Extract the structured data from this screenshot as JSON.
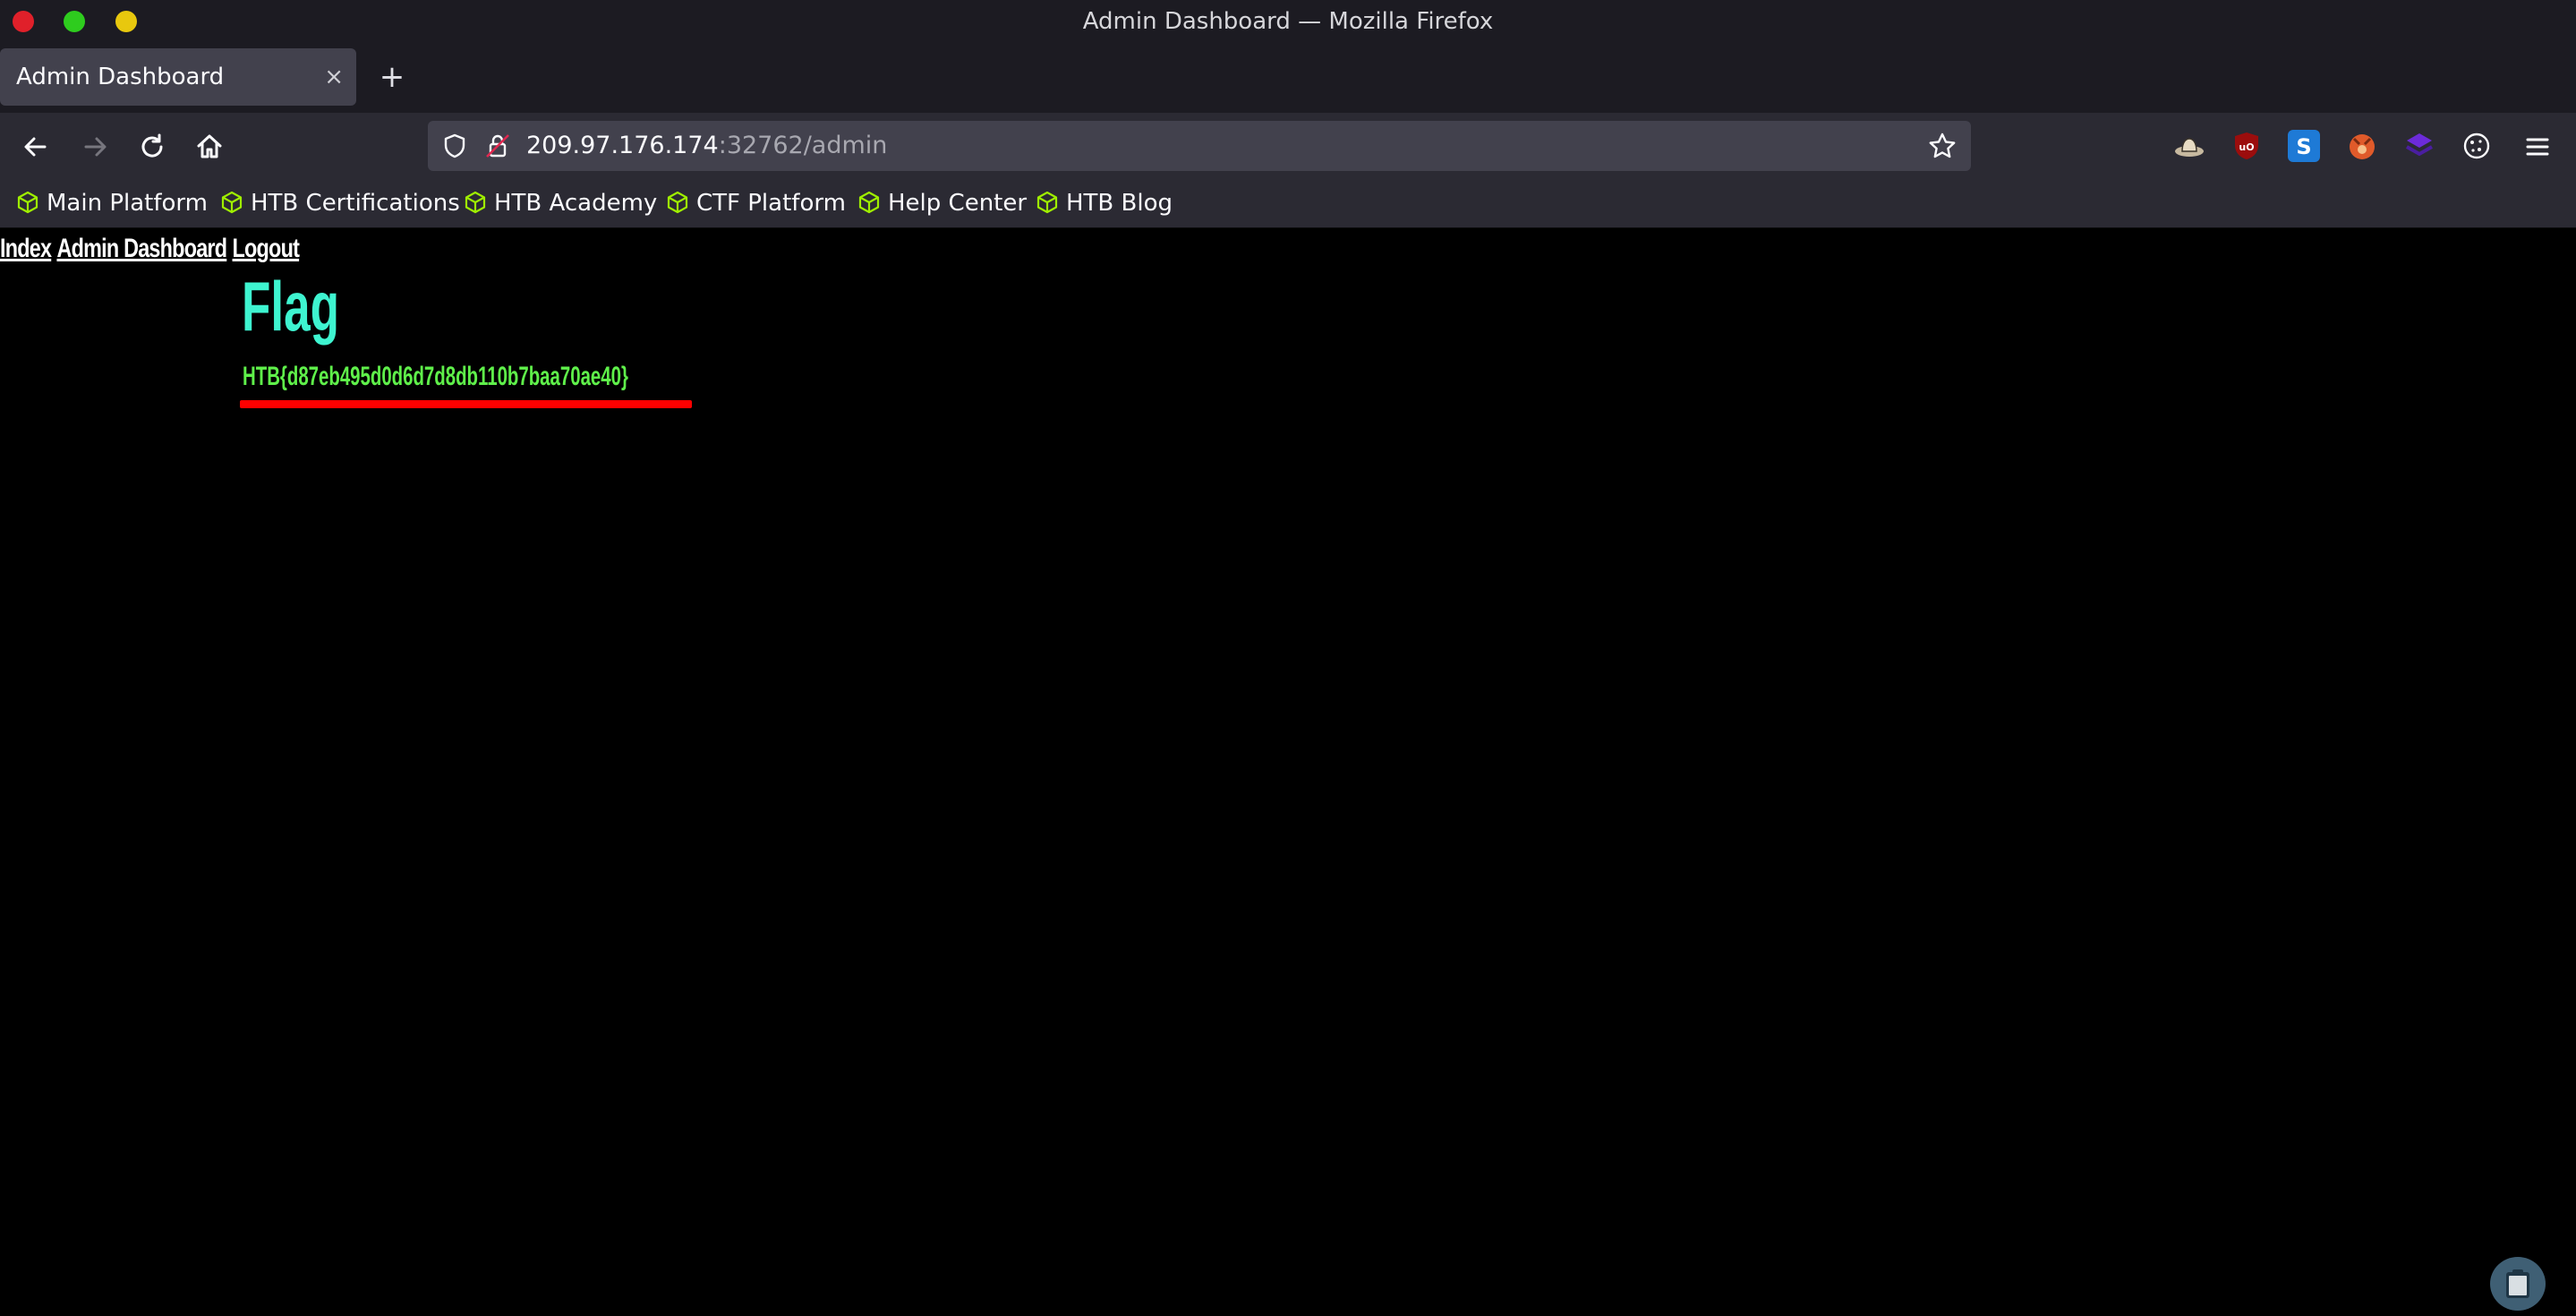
{
  "window": {
    "title": "Admin Dashboard — Mozilla Firefox"
  },
  "tabs": [
    {
      "label": "Admin Dashboard",
      "close_glyph": "×"
    }
  ],
  "new_tab_glyph": "+",
  "address": {
    "host": "209.97.176.174",
    "rest": ":32762/admin"
  },
  "bookmarks": [
    {
      "label": "Main Platform",
      "icon": "htb-cube-icon"
    },
    {
      "label": "HTB Certifications",
      "icon": "htb-cube-icon"
    },
    {
      "label": "HTB Academy",
      "icon": "htb-cube-icon"
    },
    {
      "label": "CTF Platform",
      "icon": "htb-cube-icon"
    },
    {
      "label": "Help Center",
      "icon": "htb-cube-icon"
    },
    {
      "label": "HTB Blog",
      "icon": "htb-cube-icon"
    }
  ],
  "extensions": [
    "cowboy-hat-extension-icon",
    "ublock-origin-icon",
    "s-extension-icon",
    "foxyproxy-icon",
    "wappalyzer-icon",
    "cookie-editor-icon"
  ],
  "page": {
    "nav_links": [
      "Index",
      "Admin Dashboard",
      "Logout"
    ],
    "heading": "Flag",
    "flag": "HTB{d87eb495d0d6d7d8db110b7baa70ae40}"
  },
  "colors": {
    "heading": "#3ef4d0",
    "flag": "#5ff04a",
    "highlight": "#ff0000",
    "traffic_close": "#e0202a",
    "traffic_max": "#2ecc1e",
    "traffic_min": "#e8c80e"
  }
}
